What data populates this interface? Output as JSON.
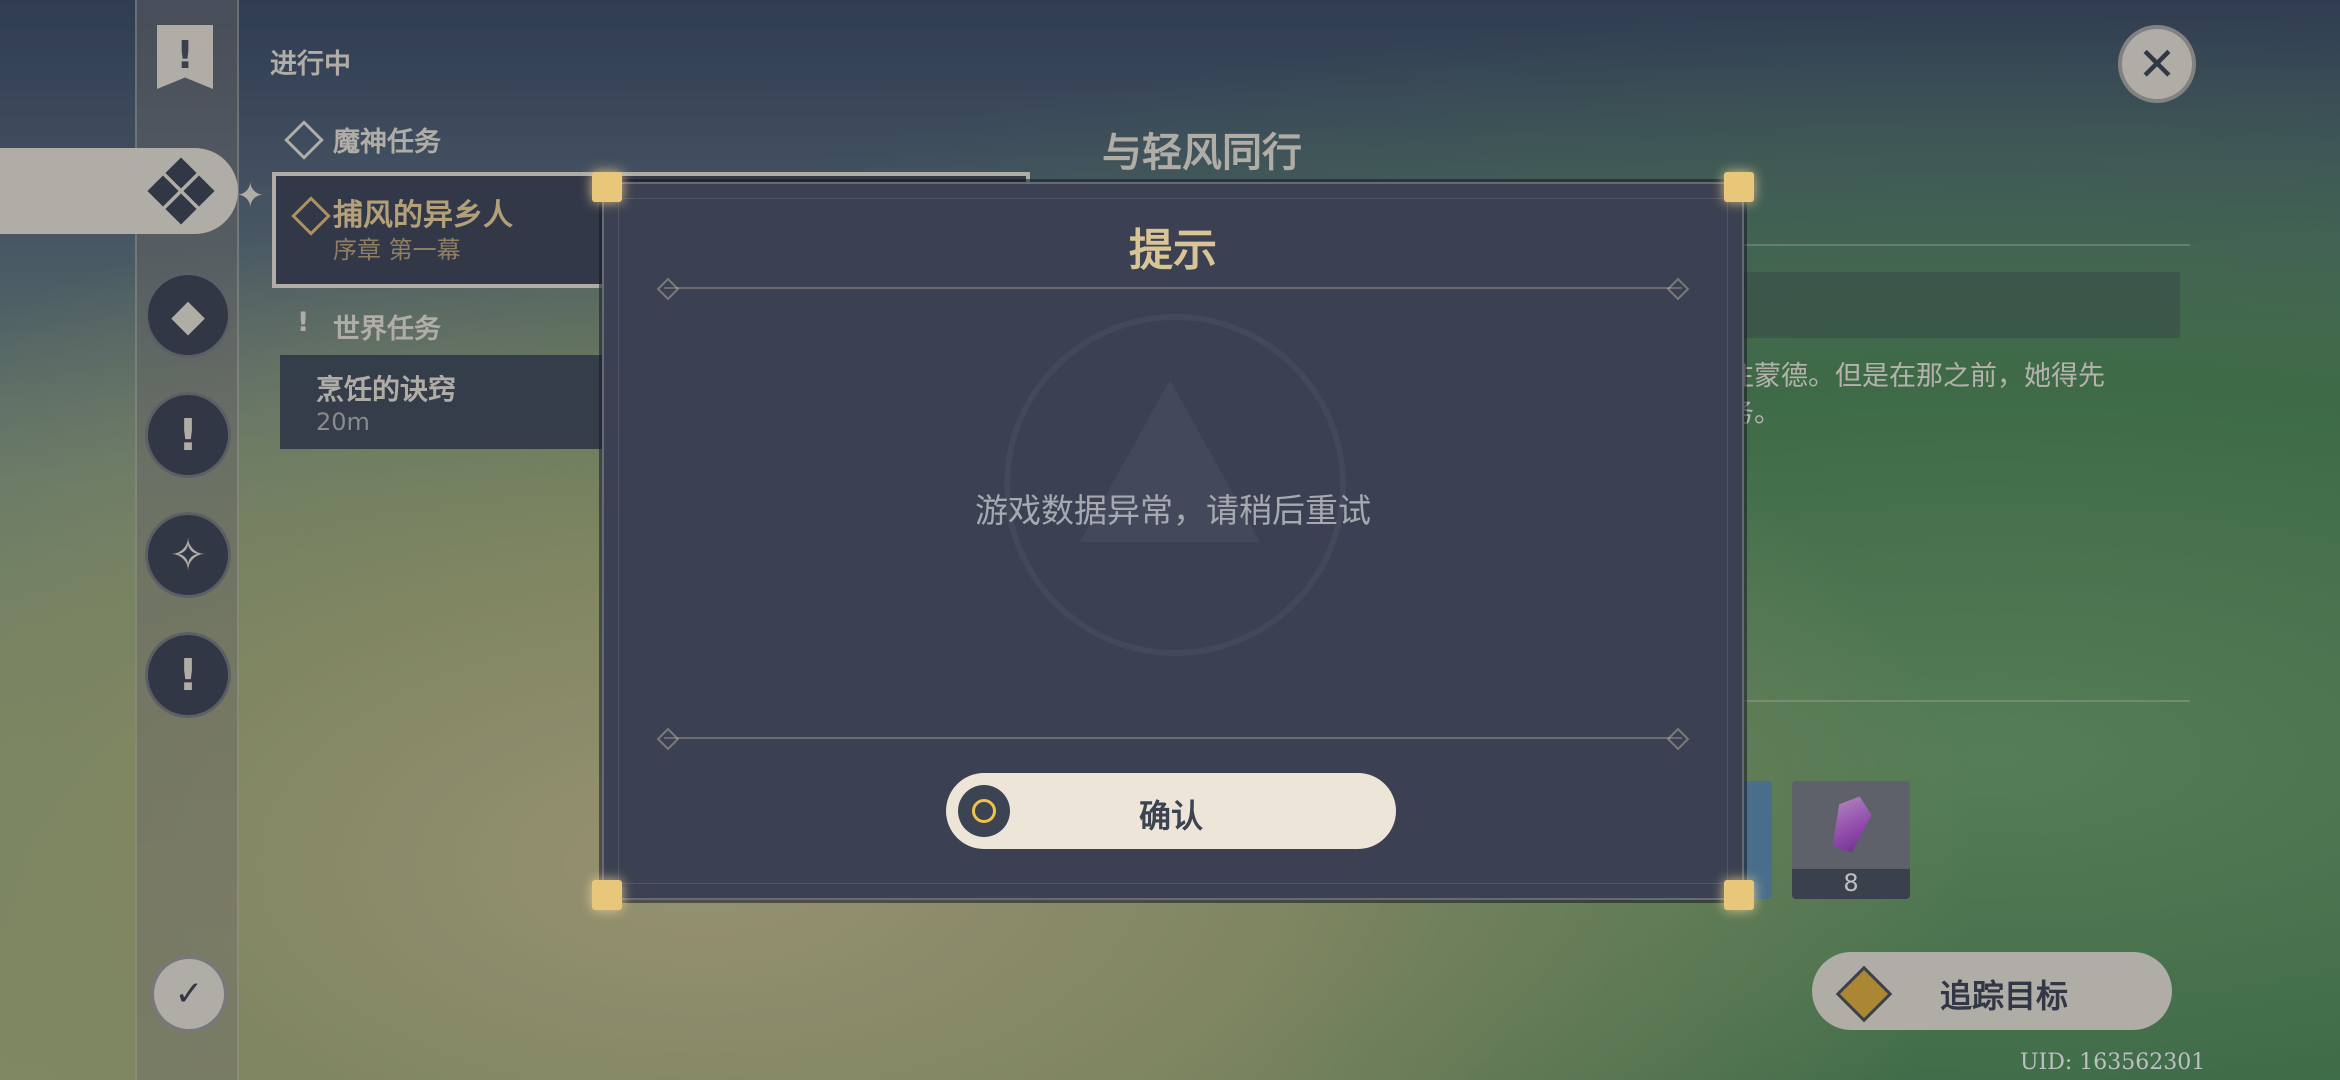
{
  "status_label": "进行中",
  "quest_sections": {
    "archon": "魔神任务",
    "world": "世界任务"
  },
  "selected_quest": {
    "title": "捕风的异乡人",
    "subtitle": "序章 第一幕"
  },
  "world_quest": {
    "title": "烹饪的诀窍",
    "distance": "20m"
  },
  "detail": {
    "title": "与轻风同行",
    "description": "前往蒙德。但是在那之前，她得先\n任务。"
  },
  "rewards": [
    {
      "name": "crystal",
      "count": "8"
    }
  ],
  "track_button": "追踪目标",
  "uid": "UID: 163562301",
  "dialog": {
    "title": "提示",
    "message": "游戏数据异常，请稍后重试",
    "confirm": "确认"
  },
  "colors": {
    "panel": "#3b4152",
    "cream": "#ece5d8",
    "gold": "#d9c495",
    "accent": "#e6b23a"
  }
}
